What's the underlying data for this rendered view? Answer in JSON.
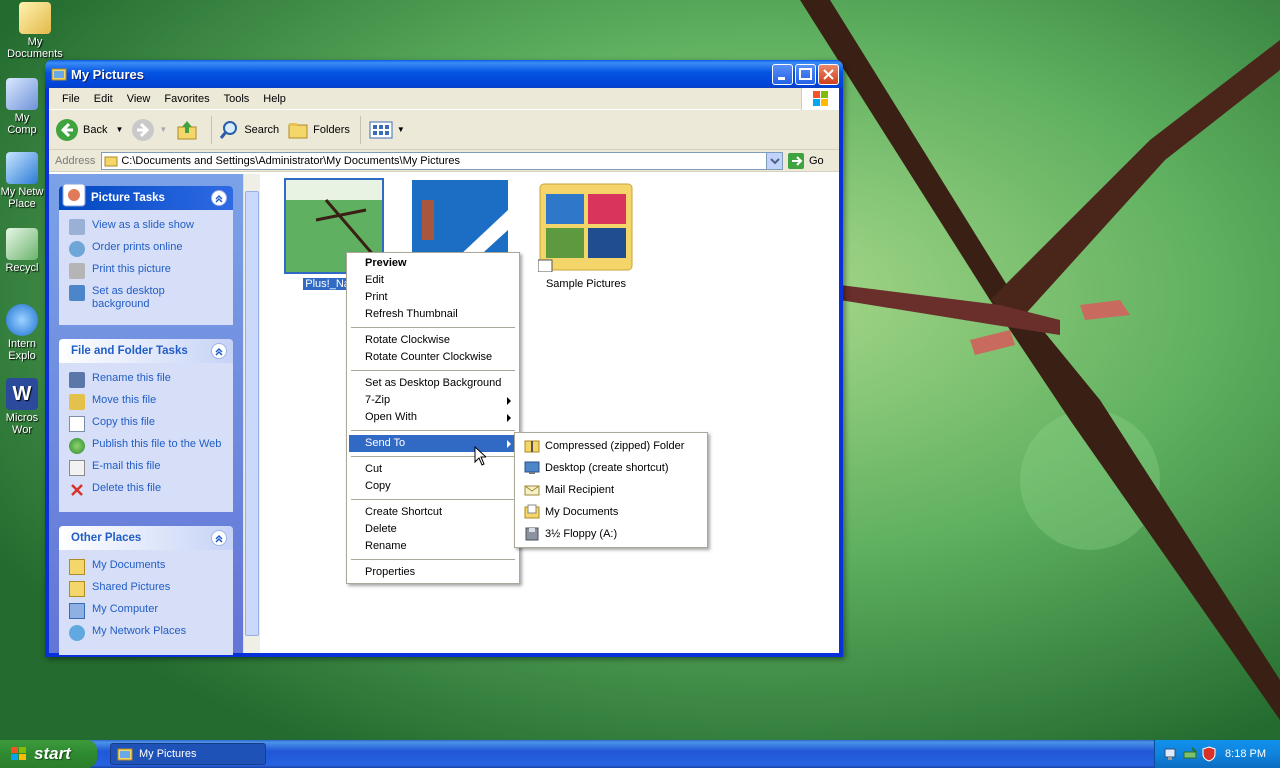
{
  "desktop": {
    "icons": [
      {
        "label": "My Documents",
        "icon": "my-documents-icon"
      },
      {
        "label": "My Comp",
        "icon": "my-computer-icon"
      },
      {
        "label": "My Netw Place",
        "icon": "network-places-icon"
      },
      {
        "label": "Recycl",
        "icon": "recycle-bin-icon"
      },
      {
        "label": "Intern Explo",
        "icon": "internet-explorer-icon"
      },
      {
        "label": "Micros Wor",
        "icon": "microsoft-word-icon"
      }
    ]
  },
  "window": {
    "title": "My Pictures",
    "menu": [
      "File",
      "Edit",
      "View",
      "Favorites",
      "Tools",
      "Help"
    ],
    "toolbar": {
      "back": "Back",
      "search": "Search",
      "folders": "Folders"
    },
    "address": {
      "label": "Address",
      "value": "C:\\Documents and Settings\\Administrator\\My Documents\\My Pictures",
      "go": "Go"
    }
  },
  "taskpane": {
    "picture_tasks": {
      "title": "Picture Tasks",
      "items": [
        "View as a slide show",
        "Order prints online",
        "Print this picture",
        "Set as desktop background"
      ]
    },
    "file_folder_tasks": {
      "title": "File and Folder Tasks",
      "items": [
        "Rename this file",
        "Move this file",
        "Copy this file",
        "Publish this file to the Web",
        "E-mail this file",
        "Delete this file"
      ]
    },
    "other_places": {
      "title": "Other Places",
      "items": [
        "My Documents",
        "Shared Pictures",
        "My Computer",
        "My Network Places"
      ]
    }
  },
  "files": [
    {
      "name": "Plus!_Natur",
      "selected": true
    },
    {
      "name": "",
      "selected": false
    },
    {
      "name": "Sample Pictures",
      "selected": false
    }
  ],
  "context_menu": {
    "items": [
      "Preview",
      "Edit",
      "Print",
      "Refresh Thumbnail",
      "Rotate Clockwise",
      "Rotate Counter Clockwise",
      "Set as Desktop Background",
      "7-Zip",
      "Open With",
      "Send To",
      "Cut",
      "Copy",
      "Create Shortcut",
      "Delete",
      "Rename",
      "Properties"
    ]
  },
  "send_to_menu": {
    "items": [
      "Compressed (zipped) Folder",
      "Desktop (create shortcut)",
      "Mail Recipient",
      "My Documents",
      "3½ Floppy (A:)"
    ]
  },
  "taskbar": {
    "start": "start",
    "task": "My Pictures",
    "clock": "8:18 PM"
  }
}
